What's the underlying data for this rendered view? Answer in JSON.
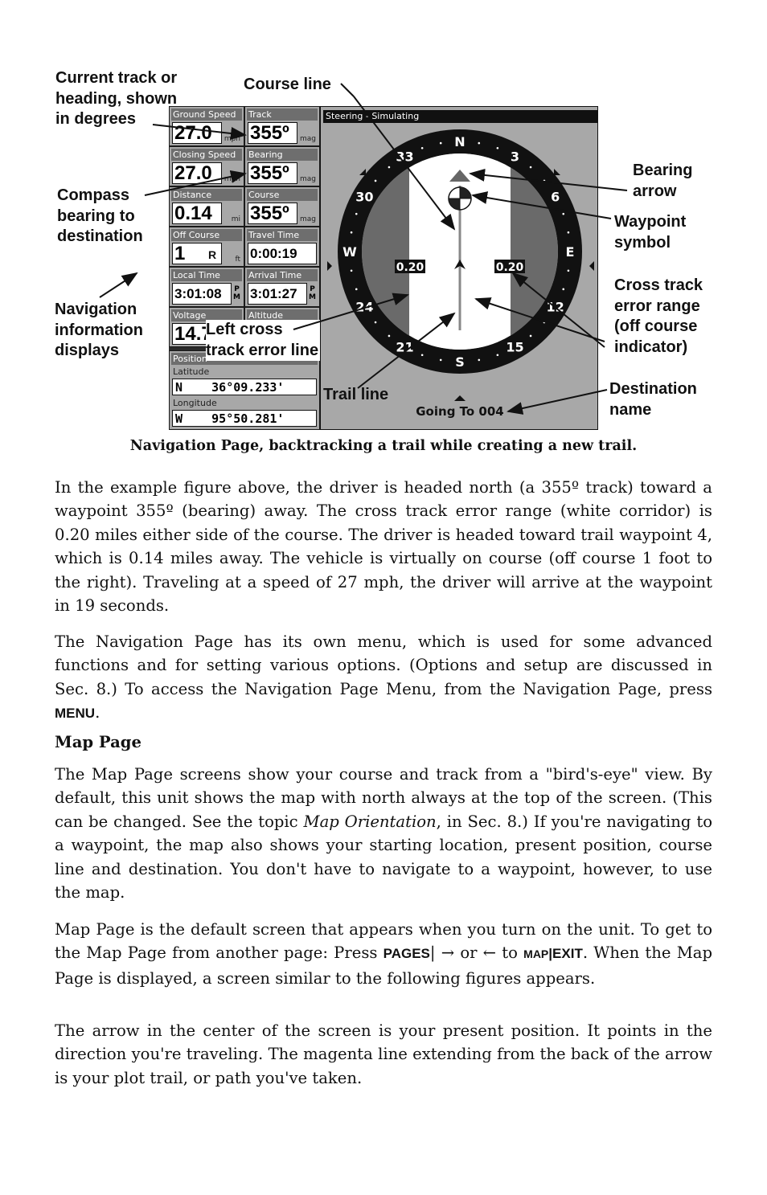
{
  "figure": {
    "callouts": {
      "current_track": "Current track or\nheading, shown\nin degrees",
      "course_line": "Course line",
      "compass_bearing": "Compass\nbearing to\ndestination",
      "nav_info": "Navigation\ninformation\ndisplays",
      "left_xte": "Left cross\ntrack error line",
      "trail_line": "Trail line",
      "bearing_arrow": "Bearing\narrow",
      "waypoint_symbol": "Waypoint\nsymbol",
      "xte_range": "Cross track\nerror range\n(off course\nindicator)",
      "destination_name": "Destination\nname"
    },
    "panel": {
      "cells": [
        {
          "title": "Ground Speed",
          "value": "27.0",
          "unit": "mph"
        },
        {
          "title": "Track",
          "value": "355º",
          "unit": "mag"
        },
        {
          "title": "Closing Speed",
          "value": "27.0",
          "unit": "mph"
        },
        {
          "title": "Bearing",
          "value": "355º",
          "unit": "mag"
        },
        {
          "title": "Distance",
          "value": "0.14",
          "unit": "mi"
        },
        {
          "title": "Course",
          "value": "355º",
          "unit": "mag"
        },
        {
          "title": "Off Course",
          "value": "1",
          "side": "R",
          "unit": "ft"
        },
        {
          "title": "Travel Time",
          "value": "0:00:19",
          "unit": ""
        },
        {
          "title": "Local Time",
          "value": "3:01:08",
          "ampm": "P\nM"
        },
        {
          "title": "Arrival Time",
          "value": "3:01:27",
          "ampm": "P\nM"
        },
        {
          "title": "Voltage",
          "value": "14.7",
          "unit": ""
        },
        {
          "title": "Altitude",
          "value": "",
          "unit": ""
        }
      ],
      "position": {
        "title": "Position",
        "lat_label": "Latitude",
        "lat_value": "N    36°09.233'",
        "lon_label": "Longitude",
        "lon_value": "W    95°50.281'"
      }
    },
    "steering": {
      "title": "Steering - Simulating",
      "compass_labels": [
        "N",
        "3",
        "6",
        "E",
        "12",
        "15",
        "S",
        "21",
        "24",
        "W",
        "30",
        "33"
      ],
      "xte_left": "0.20",
      "xte_right": "0.20",
      "going_to": "Going To 004"
    },
    "caption": "Navigation Page, backtracking a trail while creating a new trail."
  },
  "body": {
    "para1": "In the example figure above, the driver is headed north (a 355º track) toward a waypoint 355º (bearing) away. The cross track error range (white corridor) is 0.20 miles either side of the course. The driver is headed toward trail waypoint 4, which is 0.14 miles away. The vehicle is virtually on course (off course 1 foot to the right). Traveling at a speed of 27 mph, the driver will arrive at the waypoint in 19 seconds.",
    "para2_text": "The Navigation Page has its own menu, which is used for some advanced functions and for setting various options. (Options and setup are discussed in Sec. 8.) To access the Navigation Page Menu, from the Navigation Page, press ",
    "para2_key": "MENU",
    "para2_end": ".",
    "section_heading": "Map Page",
    "para3_a": "The Map Page screens show your course and track from a \"bird's-eye\" view. By default, this unit shows the map with north always at the top of the screen. (This can be changed. See the topic ",
    "para3_italic": "Map Orientation",
    "para3_b": ", in Sec. 8.) If you're navigating to a waypoint, the map also shows your starting location, present position, course line and destination. You don't have to navigate to a waypoint, however, to use the map.",
    "para4_a": "Map Page is the default screen that appears when you turn on the unit. To get to the Map Page from another page: Press ",
    "para4_key1": "PAGES",
    "para4_b": "| → or ← to ",
    "para4_key2a": "MAP",
    "para4_key2b": "|EXIT",
    "para4_c": ". When the Map Page is displayed, a screen similar to the following figures appears.",
    "para5": "The arrow in the center of the screen is your present position. It points in the direction you're traveling. The magenta line extending from the back of the arrow is your plot trail, or path you've taken."
  }
}
